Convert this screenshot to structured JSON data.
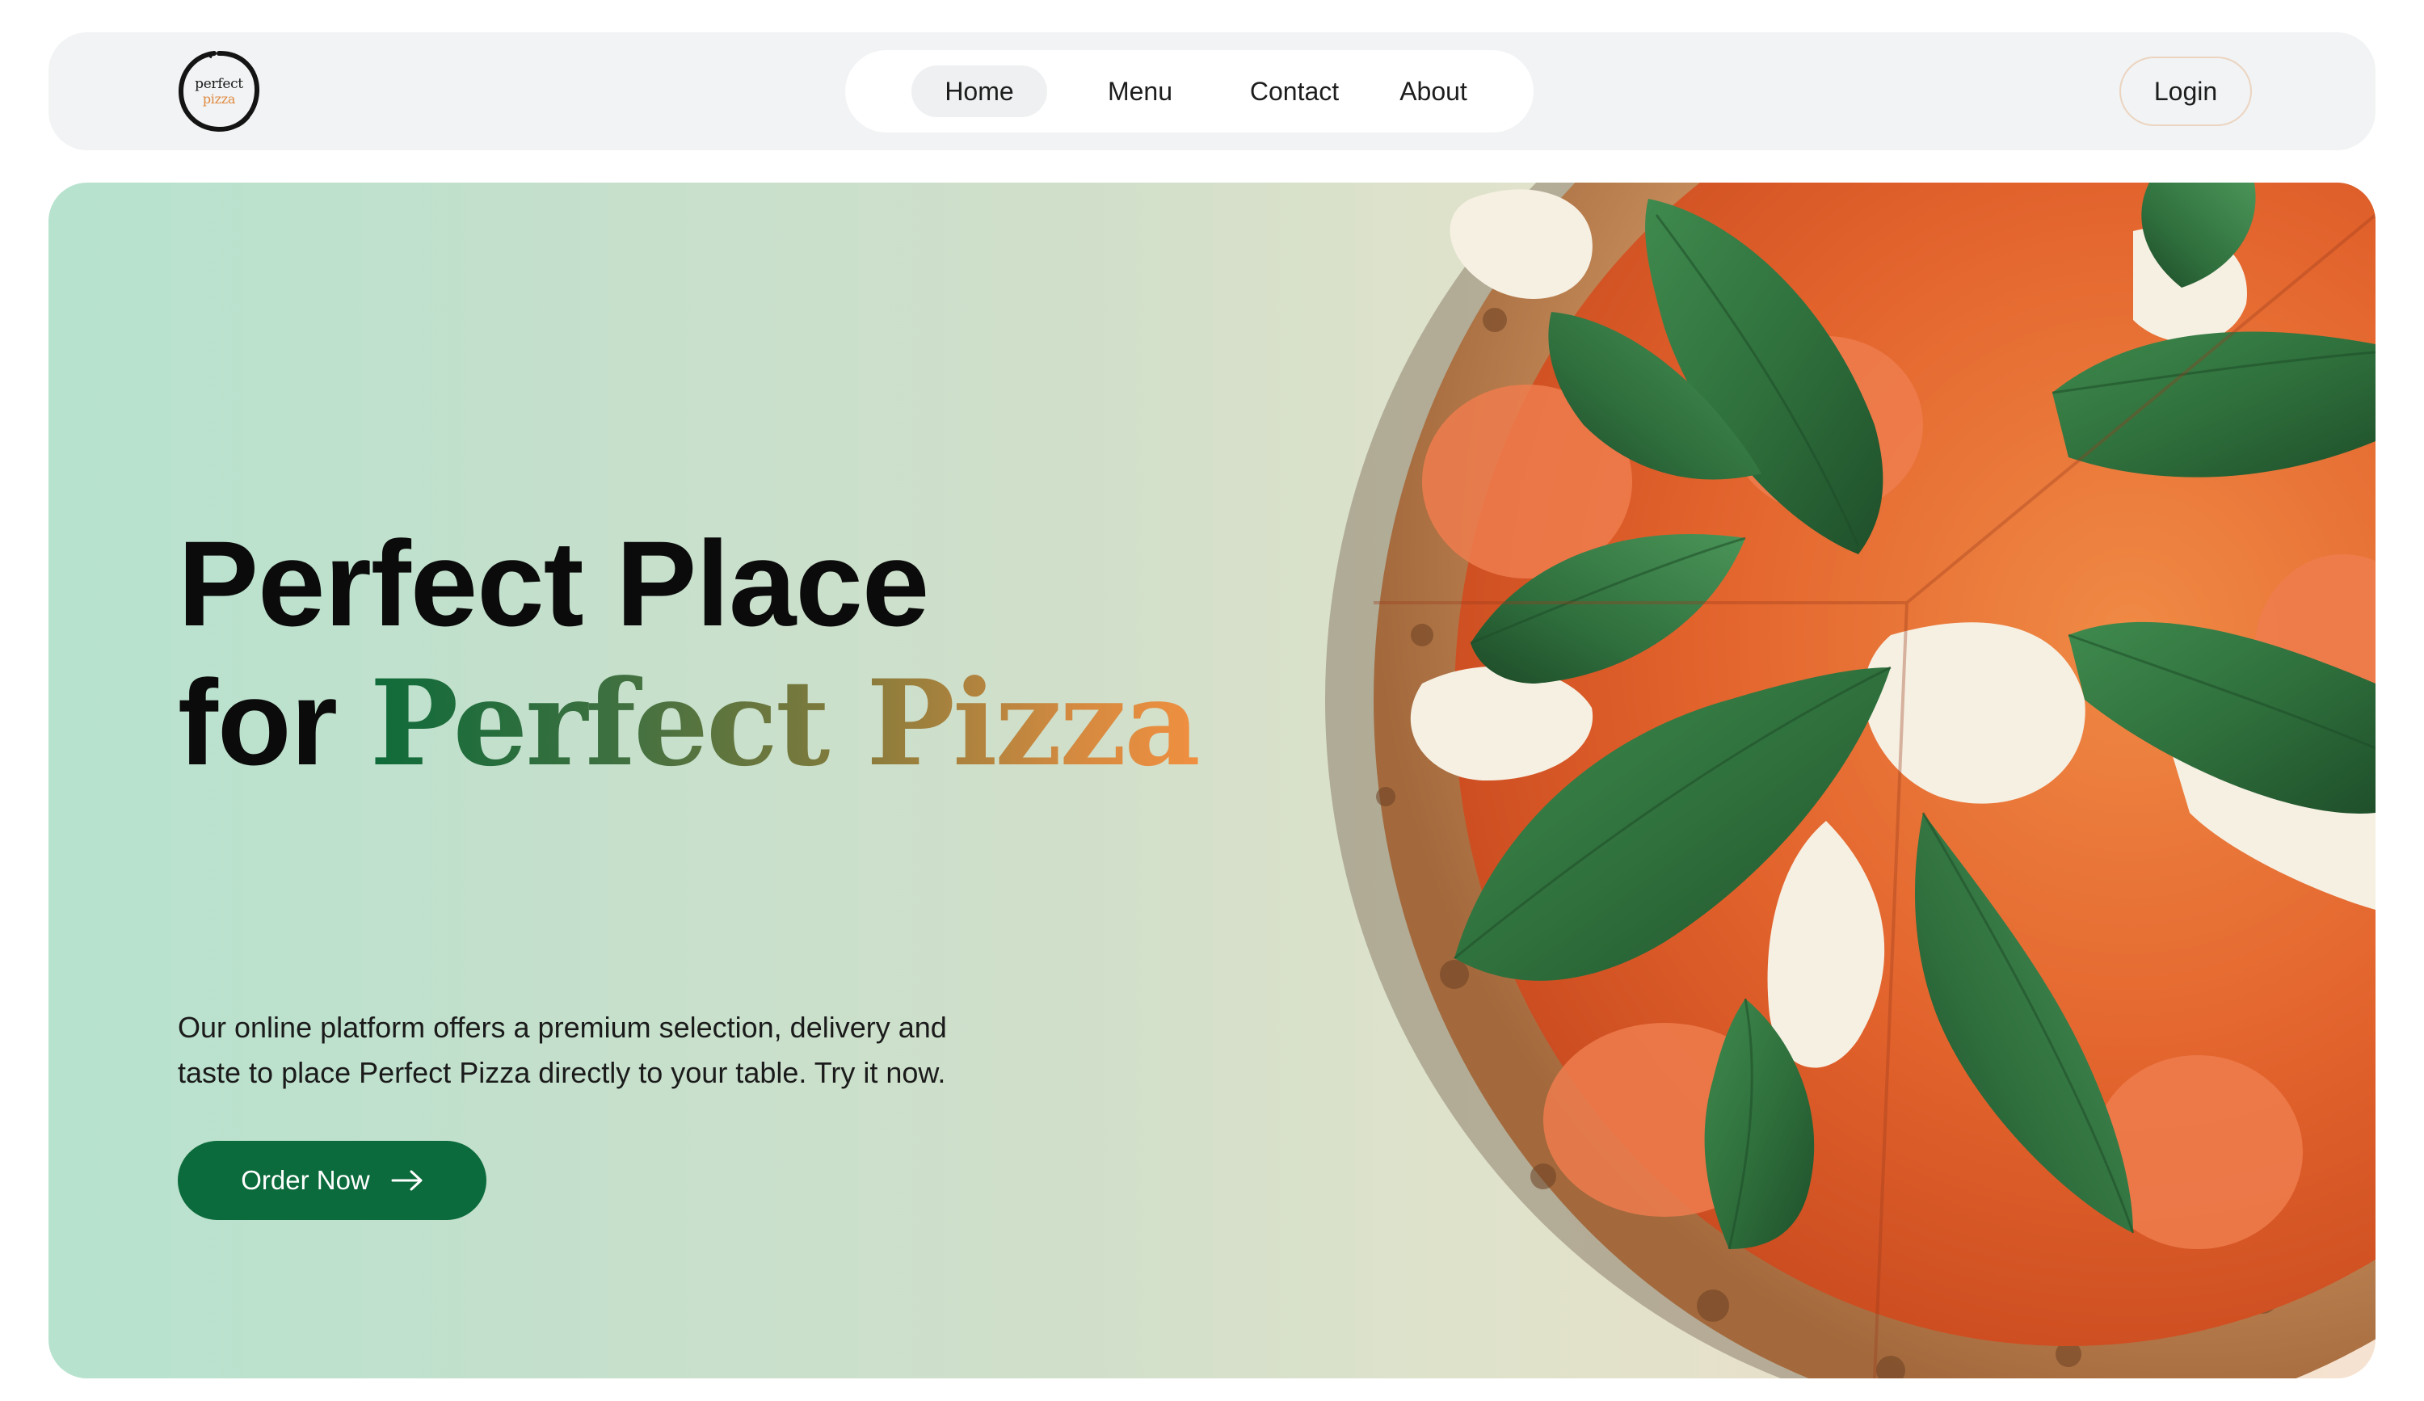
{
  "brand": {
    "logo_line1": "perfect",
    "logo_line2": "pizza"
  },
  "nav": {
    "items": [
      {
        "label": "Home",
        "active": true
      },
      {
        "label": "Menu",
        "active": false
      },
      {
        "label": "Contact",
        "active": false
      },
      {
        "label": "About",
        "active": false
      }
    ],
    "login_label": "Login"
  },
  "hero": {
    "headline_line1": "Perfect Place",
    "headline_for": "for",
    "headline_highlight": "Perfect Pizza",
    "description": "Our online platform offers a premium selection, delivery and taste to place Perfect Pizza directly to your table. Try it now.",
    "cta_label": "Order Now",
    "cta_icon": "arrow-right-icon",
    "image": "pizza-margherita-image"
  },
  "colors": {
    "accent_green": "#0c6b3c",
    "accent_orange": "#f08f40",
    "nav_bg": "#f1f3f4",
    "hero_gradient_start": "#b6e2ce",
    "hero_gradient_end": "#f6e2d0"
  }
}
